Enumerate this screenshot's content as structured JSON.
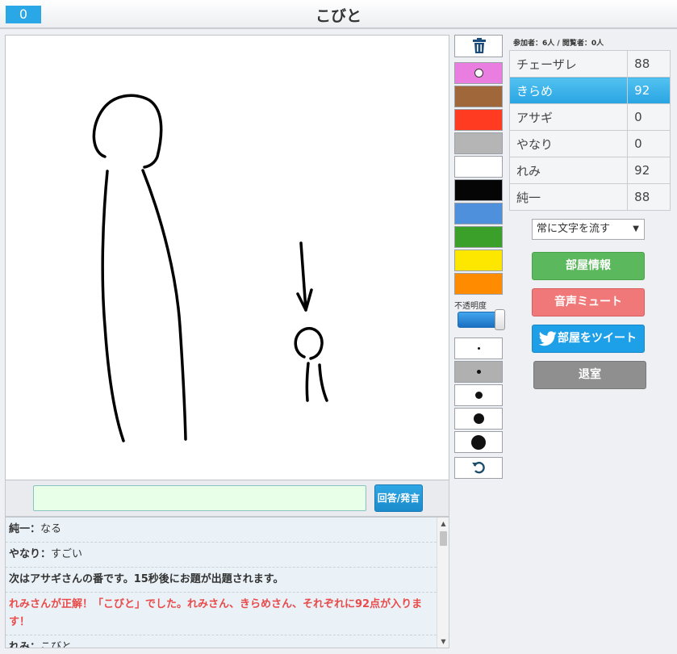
{
  "header": {
    "timer": "0",
    "title": "こびと"
  },
  "tools": {
    "colors": [
      {
        "name": "pink",
        "hex": "#e97ee0"
      },
      {
        "name": "brown",
        "hex": "#a0673b"
      },
      {
        "name": "red",
        "hex": "#ff3b22"
      },
      {
        "name": "gray",
        "hex": "#b5b5b5"
      },
      {
        "name": "white",
        "hex": "#ffffff"
      },
      {
        "name": "black",
        "hex": "#050505"
      },
      {
        "name": "blue",
        "hex": "#4e90db"
      },
      {
        "name": "green",
        "hex": "#3aa02a"
      },
      {
        "name": "yellow",
        "hex": "#fde700"
      },
      {
        "name": "orange",
        "hex": "#ff8c00"
      }
    ],
    "selected_color": "pink",
    "opacity_label": "不透明度",
    "opacity_value": 1.0,
    "pen_sizes": [
      "size-1",
      "size-2",
      "size-3",
      "size-4",
      "size-5"
    ],
    "selected_pen_size": "size-2"
  },
  "players": {
    "counts_text": "参加者：6人 / 閲覧者：0人",
    "list": [
      {
        "name": "チェーザレ",
        "score": "88"
      },
      {
        "name": "きらめ",
        "score": "92",
        "active": true
      },
      {
        "name": "アサギ",
        "score": "0"
      },
      {
        "name": "やなり",
        "score": "0"
      },
      {
        "name": "れみ",
        "score": "92"
      },
      {
        "name": "純一",
        "score": "88"
      }
    ]
  },
  "controls": {
    "scroll_option": "常に文字を流す",
    "room_info": "部屋情報",
    "mute": "音声ミュート",
    "tweet": "部屋をツイート",
    "exit": "退室"
  },
  "answer": {
    "placeholder": "",
    "button": "回答/発言"
  },
  "chat": [
    {
      "speaker": "純一",
      "sep": "：",
      "text": "なる",
      "kind": "user"
    },
    {
      "speaker": "やなり",
      "sep": "：",
      "text": "すごい",
      "kind": "user"
    },
    {
      "speaker": "",
      "sep": "",
      "text": "次はアサギさんの番です。15秒後にお題が出題されます。",
      "kind": "sys"
    },
    {
      "speaker": "",
      "sep": "",
      "text": "れみさんが正解！「こびと」でした。れみさん、きらめさん、それぞれに92点が入ります！",
      "kind": "correct"
    },
    {
      "speaker": "れみ",
      "sep": "：",
      "text": "こびと",
      "kind": "user"
    }
  ],
  "colors": {
    "accent_blue": "#2aa7e6",
    "info_green": "#5cb85c",
    "mute_red": "#f07878",
    "tweet_blue": "#1ea0e8",
    "exit_gray": "#8f8f8f",
    "input_bg": "#e8ffe8"
  }
}
